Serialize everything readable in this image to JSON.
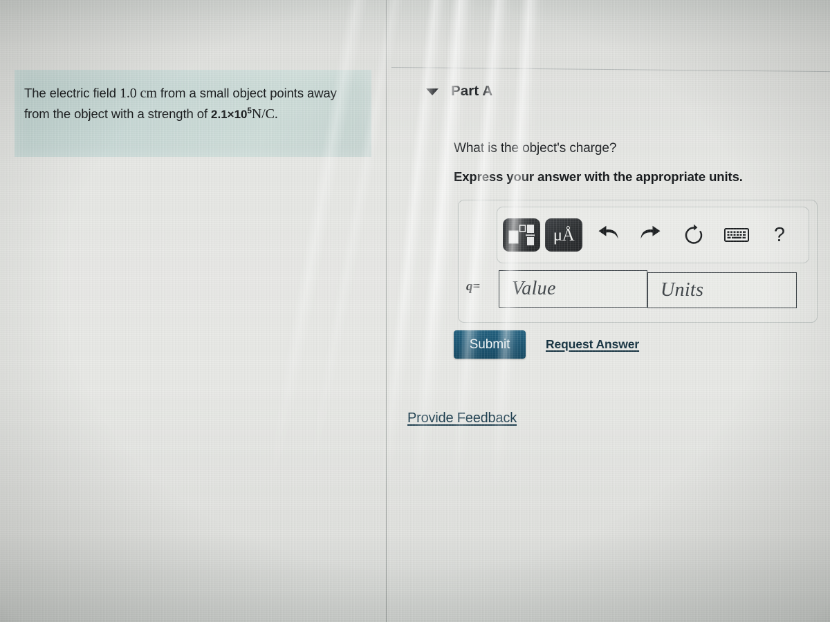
{
  "problem": {
    "text_part1": "The electric field ",
    "distance": "1.0 cm",
    "text_part2": " from a small object points away from the object with a strength of ",
    "field_mantissa": "2.1×10",
    "field_exponent": "5",
    "field_units": "N/C."
  },
  "part": {
    "collapse_icon": "caret-down-icon",
    "title": "Part A",
    "question": "What is the object's charge?",
    "instruction": "Express your answer with the appropriate units."
  },
  "toolbar": {
    "items": [
      {
        "name": "math-template-icon",
        "label": "",
        "style": "dark"
      },
      {
        "name": "units-micro-angstrom-icon",
        "label": "μÅ",
        "style": "dark"
      },
      {
        "name": "undo-icon",
        "label": "",
        "style": "plain"
      },
      {
        "name": "redo-icon",
        "label": "",
        "style": "plain"
      },
      {
        "name": "reset-icon",
        "label": "",
        "style": "plain"
      },
      {
        "name": "keyboard-icon",
        "label": "",
        "style": "plain"
      },
      {
        "name": "help-icon",
        "label": "?",
        "style": "plain"
      }
    ]
  },
  "answer": {
    "variable_label": "q",
    "equals_sign": "=",
    "value_placeholder": "Value",
    "value_current": "",
    "units_placeholder": "Units",
    "units_current": ""
  },
  "actions": {
    "submit_label": "Submit",
    "request_answer_label": "Request Answer",
    "provide_feedback_label": "Provide Feedback"
  },
  "colors": {
    "problem_box_tint": "#c8d8d5",
    "submit_button": "#1b5471",
    "link": "#14313f",
    "page_background": "#e3e4e2",
    "toolbar_dark_button": "#2f3234"
  }
}
